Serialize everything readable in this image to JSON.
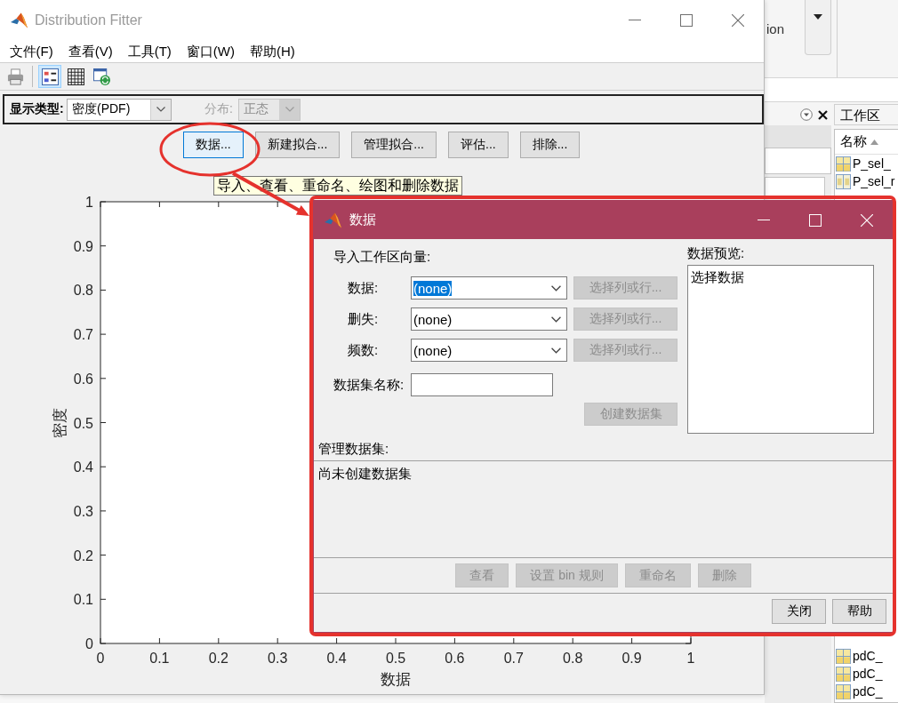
{
  "desktop": {
    "ribbon_text": "ion",
    "workspace": {
      "title": "工作区",
      "column": "名称",
      "upper_rows": [
        {
          "name": "P_sel_",
          "kind": "matrix"
        },
        {
          "name": "P_sel_r",
          "kind": "char"
        }
      ],
      "lower_rows": [
        {
          "name": "pdC_",
          "kind": "matrix"
        },
        {
          "name": "pdC_",
          "kind": "matrix"
        },
        {
          "name": "pdC_",
          "kind": "matrix"
        }
      ]
    }
  },
  "fitter": {
    "title": "Distribution Fitter",
    "active": false,
    "menu": [
      "文件(F)",
      "查看(V)",
      "工具(T)",
      "窗口(W)",
      "帮助(H)"
    ],
    "toolbar": [
      {
        "kind": "print",
        "selected": false
      },
      {
        "kind": "legend",
        "selected": true
      },
      {
        "kind": "grid",
        "selected": false
      },
      {
        "kind": "refresh",
        "selected": false
      }
    ],
    "display_type": {
      "label": "显示类型:",
      "value": "密度(PDF)"
    },
    "distribution": {
      "label": "分布:",
      "value": "正态",
      "disabled": true
    },
    "buttons": [
      {
        "label": "数据...",
        "focused": true
      },
      {
        "label": "新建拟合...",
        "focused": false
      },
      {
        "label": "管理拟合...",
        "focused": false
      },
      {
        "label": "评估...",
        "focused": false
      },
      {
        "label": "排除...",
        "focused": false
      }
    ],
    "tooltip": "导入、查看、重命名、绘图和删除数据",
    "chart_data": {
      "type": "line",
      "xlabel": "数据",
      "ylabel": "密度",
      "xlim": [
        0,
        1
      ],
      "ylim": [
        0,
        1
      ],
      "xticks": [
        0,
        0.1,
        0.2,
        0.3,
        0.4,
        0.5,
        0.6,
        0.7,
        0.8,
        0.9,
        1
      ],
      "yticks": [
        0,
        0.1,
        0.2,
        0.3,
        0.4,
        0.5,
        0.6,
        0.7,
        0.8,
        0.9,
        1
      ]
    }
  },
  "data_dialog": {
    "title": "数据",
    "active": true,
    "import_heading": "导入工作区向量:",
    "fields": [
      {
        "label": "数据:",
        "value": "(none)",
        "focused": true,
        "button": {
          "label": "选择列或行...",
          "disabled": true
        }
      },
      {
        "label": "删失:",
        "value": "(none)",
        "focused": false,
        "button": {
          "label": "选择列或行...",
          "disabled": true
        }
      },
      {
        "label": "频数:",
        "value": "(none)",
        "focused": false,
        "button": {
          "label": "选择列或行...",
          "disabled": true
        }
      }
    ],
    "dataset_name_label": "数据集名称:",
    "create_button": {
      "label": "创建数据集",
      "disabled": true
    },
    "preview": {
      "label": "数据预览:",
      "text": "选择数据"
    },
    "manage": {
      "label": "管理数据集:",
      "empty_text": "尚未创建数据集"
    },
    "manage_buttons": [
      {
        "label": "查看",
        "disabled": true
      },
      {
        "label": "设置 bin 规则",
        "disabled": true
      },
      {
        "label": "重命名",
        "disabled": true
      },
      {
        "label": "删除",
        "disabled": true
      }
    ],
    "footer_buttons": [
      {
        "label": "关闭",
        "disabled": false
      },
      {
        "label": "帮助",
        "disabled": false
      }
    ]
  }
}
